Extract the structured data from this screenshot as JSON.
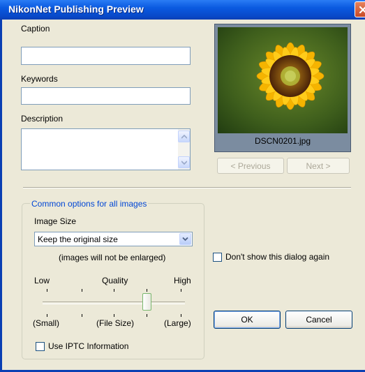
{
  "window": {
    "title": "NikonNet Publishing Preview",
    "title_bar_color": "#0a5ae0"
  },
  "form": {
    "caption_label": "Caption",
    "caption_value": "",
    "keywords_label": "Keywords",
    "keywords_value": "",
    "description_label": "Description",
    "description_value": ""
  },
  "preview": {
    "image_name": "sunflower-photo",
    "filename": "DSCN0201.jpg",
    "previous_label": "< Previous",
    "next_label": "Next >"
  },
  "options": {
    "group_label": "Common options for all images",
    "image_size_label": "Image Size",
    "image_size_selected": "Keep the original size",
    "enlarge_note": "(images will not be enlarged)",
    "quality": {
      "low_label": "Low",
      "mid_label": "Quality",
      "high_label": "High",
      "small_label": "(Small)",
      "file_size_label": "(File Size)",
      "large_label": "(Large)",
      "slider_value_fraction": 0.75
    },
    "use_iptc_label": "Use IPTC Information",
    "use_iptc_checked": false
  },
  "dialog": {
    "dont_show_label": "Don't show this dialog again",
    "dont_show_checked": false,
    "ok_label": "OK",
    "cancel_label": "Cancel"
  }
}
